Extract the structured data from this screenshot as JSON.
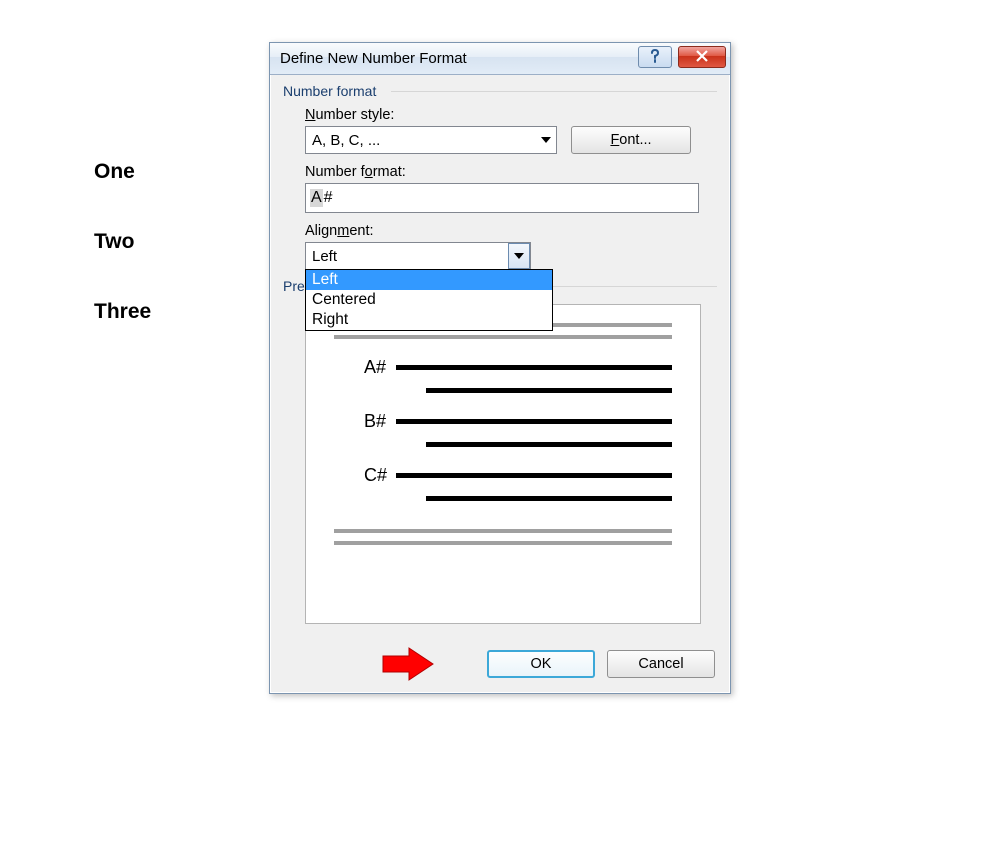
{
  "side_labels": [
    "One",
    "Two",
    "Three"
  ],
  "dialog": {
    "title": "Define New Number Format",
    "group_label": "Number format",
    "number_style": {
      "label_pre": "N",
      "label_post": "umber style:",
      "selected": "A, B, C, ..."
    },
    "font_button": {
      "pre": "F",
      "post": "ont..."
    },
    "number_format": {
      "label_pre": "Number f",
      "label_u": "o",
      "label_post": "rmat:",
      "value_ghost": "A",
      "value_rest": "#"
    },
    "alignment": {
      "label_pre": "Align",
      "label_u": "m",
      "label_post": "ent:",
      "selected": "Left",
      "options": [
        "Left",
        "Centered",
        "Right"
      ]
    },
    "preview_label": "Preview",
    "preview_items": [
      "A#",
      "B#",
      "C#"
    ],
    "ok": "OK",
    "cancel": "Cancel"
  }
}
